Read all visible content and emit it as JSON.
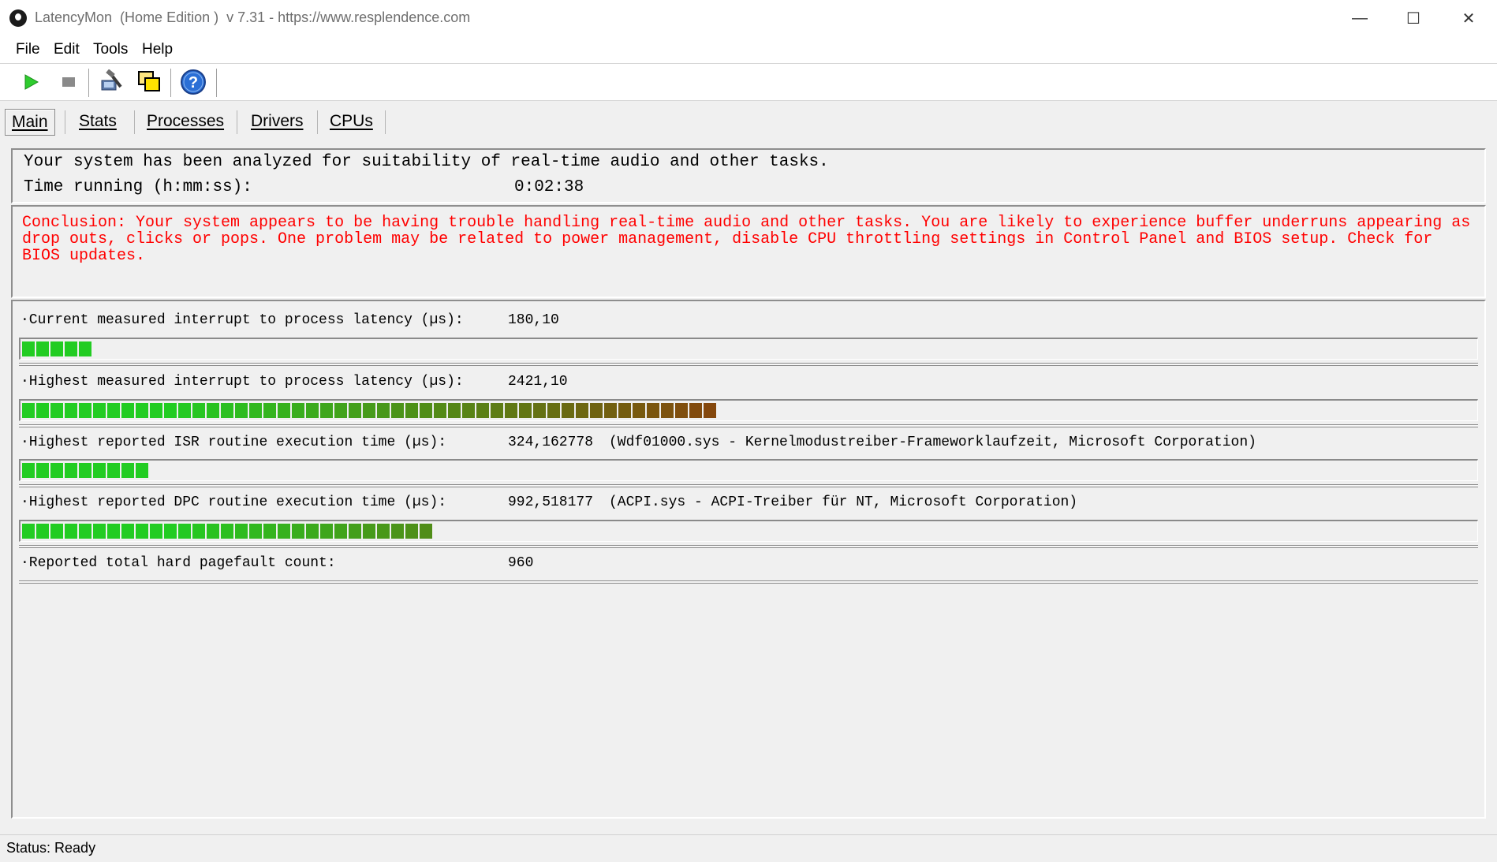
{
  "window": {
    "title": "LatencyMon  (Home Edition )  v 7.31 - https://www.resplendence.com",
    "minimize": "—",
    "maximize": "☐",
    "close": "✕"
  },
  "menu": {
    "file": "File",
    "edit": "Edit",
    "tools": "Tools",
    "help": "Help"
  },
  "toolbar": {
    "icons": [
      "play-icon",
      "stop-icon",
      "analyze-icon",
      "windows-icon",
      "help-icon"
    ],
    "colors": {
      "play": "#2ecc2e",
      "stop": "#808080",
      "help": "#2a6fd6"
    }
  },
  "tabs": [
    "Main",
    "Stats",
    "Processes",
    "Drivers",
    "CPUs"
  ],
  "summary": {
    "analyzed": "Your system has been analyzed for suitability of real-time audio and other tasks.",
    "time_label": "Time running (h:mm:ss):",
    "time_value": "0:02:38"
  },
  "conclusion": {
    "text": "Conclusion: Your system appears to be having trouble handling real-time audio and other tasks. You are likely to experience buffer underruns appearing as drop outs, clicks or pops. One problem may be related to power management, disable CPU throttling settings in Control Panel and BIOS setup. Check for BIOS updates.",
    "color": "#ff0000"
  },
  "metrics": [
    {
      "label": "·Current measured interrupt to process latency (µs):",
      "value": "180,10",
      "detail": "",
      "level": 0.052
    },
    {
      "label": "·Highest measured interrupt to process latency (µs):",
      "value": "2421,10",
      "detail": "",
      "level": 0.477
    },
    {
      "label": "·Highest reported ISR routine execution time (µs):",
      "value": "324,162778",
      "detail": "(Wdf01000.sys - Kernelmodustreiber-Frameworklaufzeit, Microsoft Corporation)",
      "level": 0.087
    },
    {
      "label": "·Highest reported DPC routine execution time (µs):",
      "value": "992,518177",
      "detail": "(ACPI.sys - ACPI-Treiber für NT, Microsoft Corporation)",
      "level": 0.283
    },
    {
      "label": "·Reported total hard pagefault count:",
      "value": "960",
      "detail": ""
    }
  ],
  "status": "Status: Ready"
}
